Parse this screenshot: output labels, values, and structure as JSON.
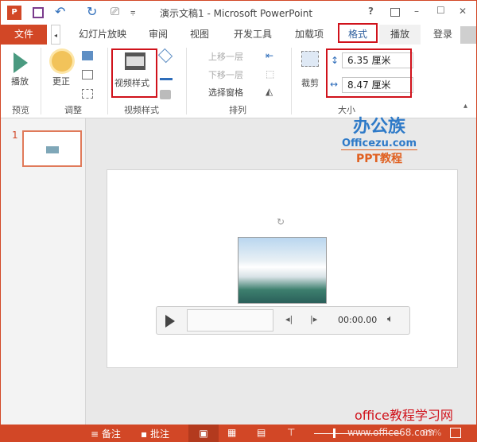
{
  "title": "演示文稿1 - Microsoft PowerPoint",
  "title_controls": {
    "help": "?",
    "minimize": "–",
    "maximize": "☐",
    "close": "✕"
  },
  "tabs": [
    {
      "label": "文件"
    },
    {
      "label": "幻灯片放映"
    },
    {
      "label": "审阅"
    },
    {
      "label": "视图"
    },
    {
      "label": "开发工具"
    },
    {
      "label": "加载项"
    },
    {
      "label": "格式",
      "active": true
    },
    {
      "label": "播放"
    }
  ],
  "login": "登录",
  "ribbon": {
    "play": "播放",
    "correct": "更正",
    "video_style": "视频样式",
    "bring_forward": "上移一层",
    "send_backward": "下移一层",
    "selection_pane": "选择窗格",
    "crop": "裁剪",
    "height": "6.35 厘米",
    "width": "8.47 厘米",
    "groups": [
      "预览",
      "调整",
      "视频样式",
      "排列",
      "大小"
    ]
  },
  "watermark": {
    "logo": "办公族",
    "site": "Officezu.com",
    "sub": "PPT教程",
    "bottom": "office教程学习网",
    "url": "www.office68.com"
  },
  "thumbnail": {
    "number": "1"
  },
  "player": {
    "time": "00:00.00"
  },
  "status": {
    "notes": "备注",
    "comments": "批注",
    "zoom": "65%"
  },
  "colors": {
    "accent": "#d24726",
    "highlight": "#d0121b"
  }
}
